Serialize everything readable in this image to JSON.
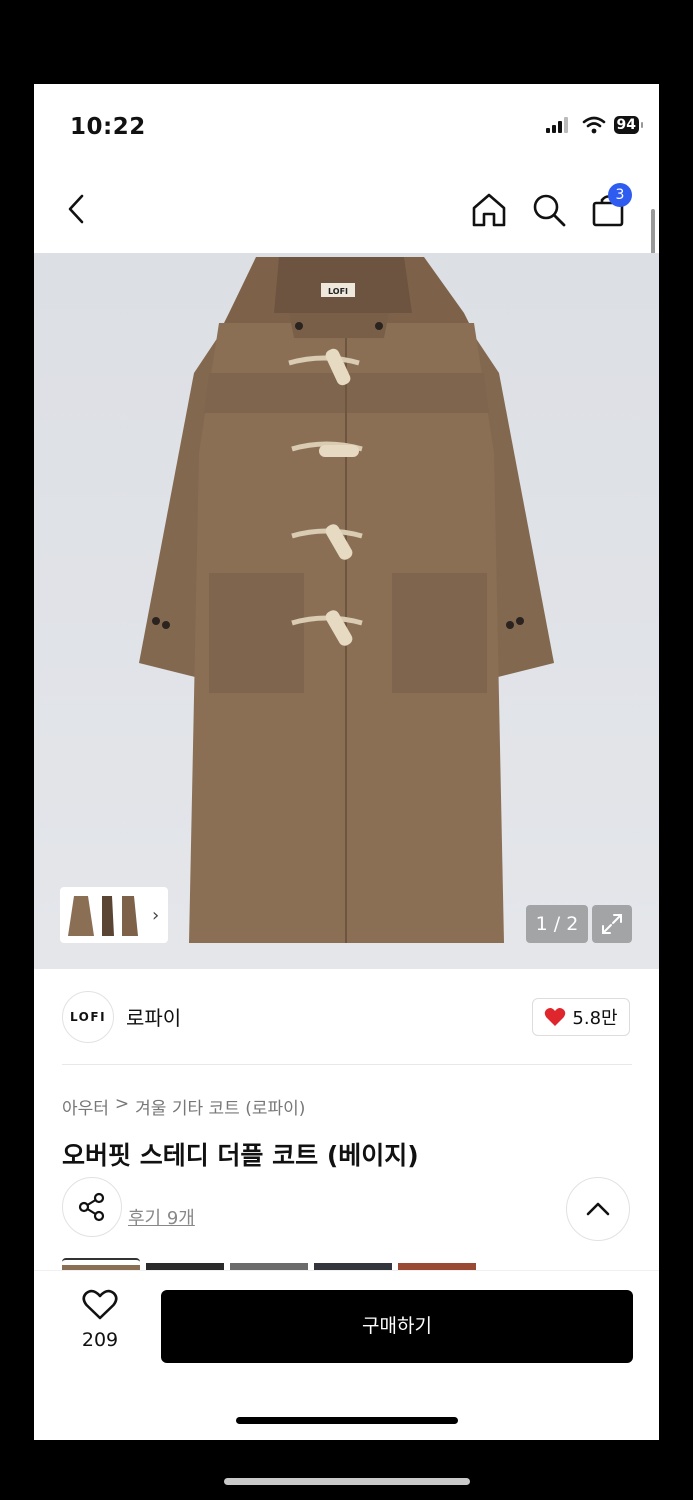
{
  "status_bar": {
    "time": "10:22",
    "battery": "94"
  },
  "nav": {
    "cart_badge": "3"
  },
  "product_image": {
    "page_indicator": "1 / 2",
    "coat_color": "#8a6f55",
    "brand_label": "LOFI"
  },
  "brand": {
    "logo_text": "LOFI",
    "name": "로파이",
    "likes": "5.8만"
  },
  "breadcrumb": {
    "category": "아우터",
    "separator": ">",
    "subcategory": "겨울 기타 코트 (로파이)"
  },
  "product": {
    "title": "오버핏 스테디 더플 코트 (베이지)",
    "reviews": "후기 9개"
  },
  "colors": {
    "swatches": [
      "#8a6f55",
      "#2b2b2b",
      "#6b6b6b",
      "#33363d",
      "#9a4a33"
    ]
  },
  "bottom_bar": {
    "wish_count": "209",
    "buy_label": "구매하기"
  },
  "theme": {
    "accent": "#2f5cf0",
    "heart": "#e0262d",
    "buy_bg": "#000000"
  }
}
